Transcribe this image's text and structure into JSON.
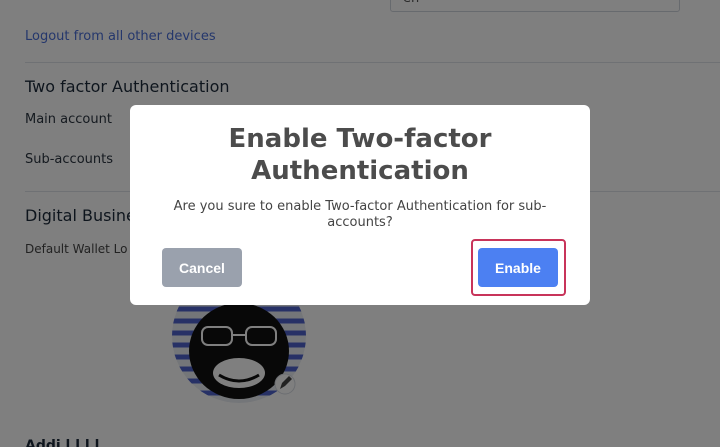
{
  "settings": {
    "language_value": "en",
    "logout_link": "Logout from all other devices",
    "two_factor_title": "Two factor Authentication",
    "main_account_label": "Main account",
    "sub_accounts_label": "Sub-accounts",
    "digital_business_title": "Digital Busine",
    "default_wallet_label": "Default Wallet Lo",
    "bottom_heading": "Addi   l   l  l   l"
  },
  "modal": {
    "title": "Enable Two-factor Authentication",
    "message": "Are you sure to enable Two-factor Authentication for sub-accounts?",
    "cancel_label": "Cancel",
    "enable_label": "Enable"
  },
  "colors": {
    "link": "#4a6fd8",
    "enable_button": "#4c80f2",
    "cancel_button": "#9aa1ad",
    "focus_ring": "#c8345a"
  }
}
